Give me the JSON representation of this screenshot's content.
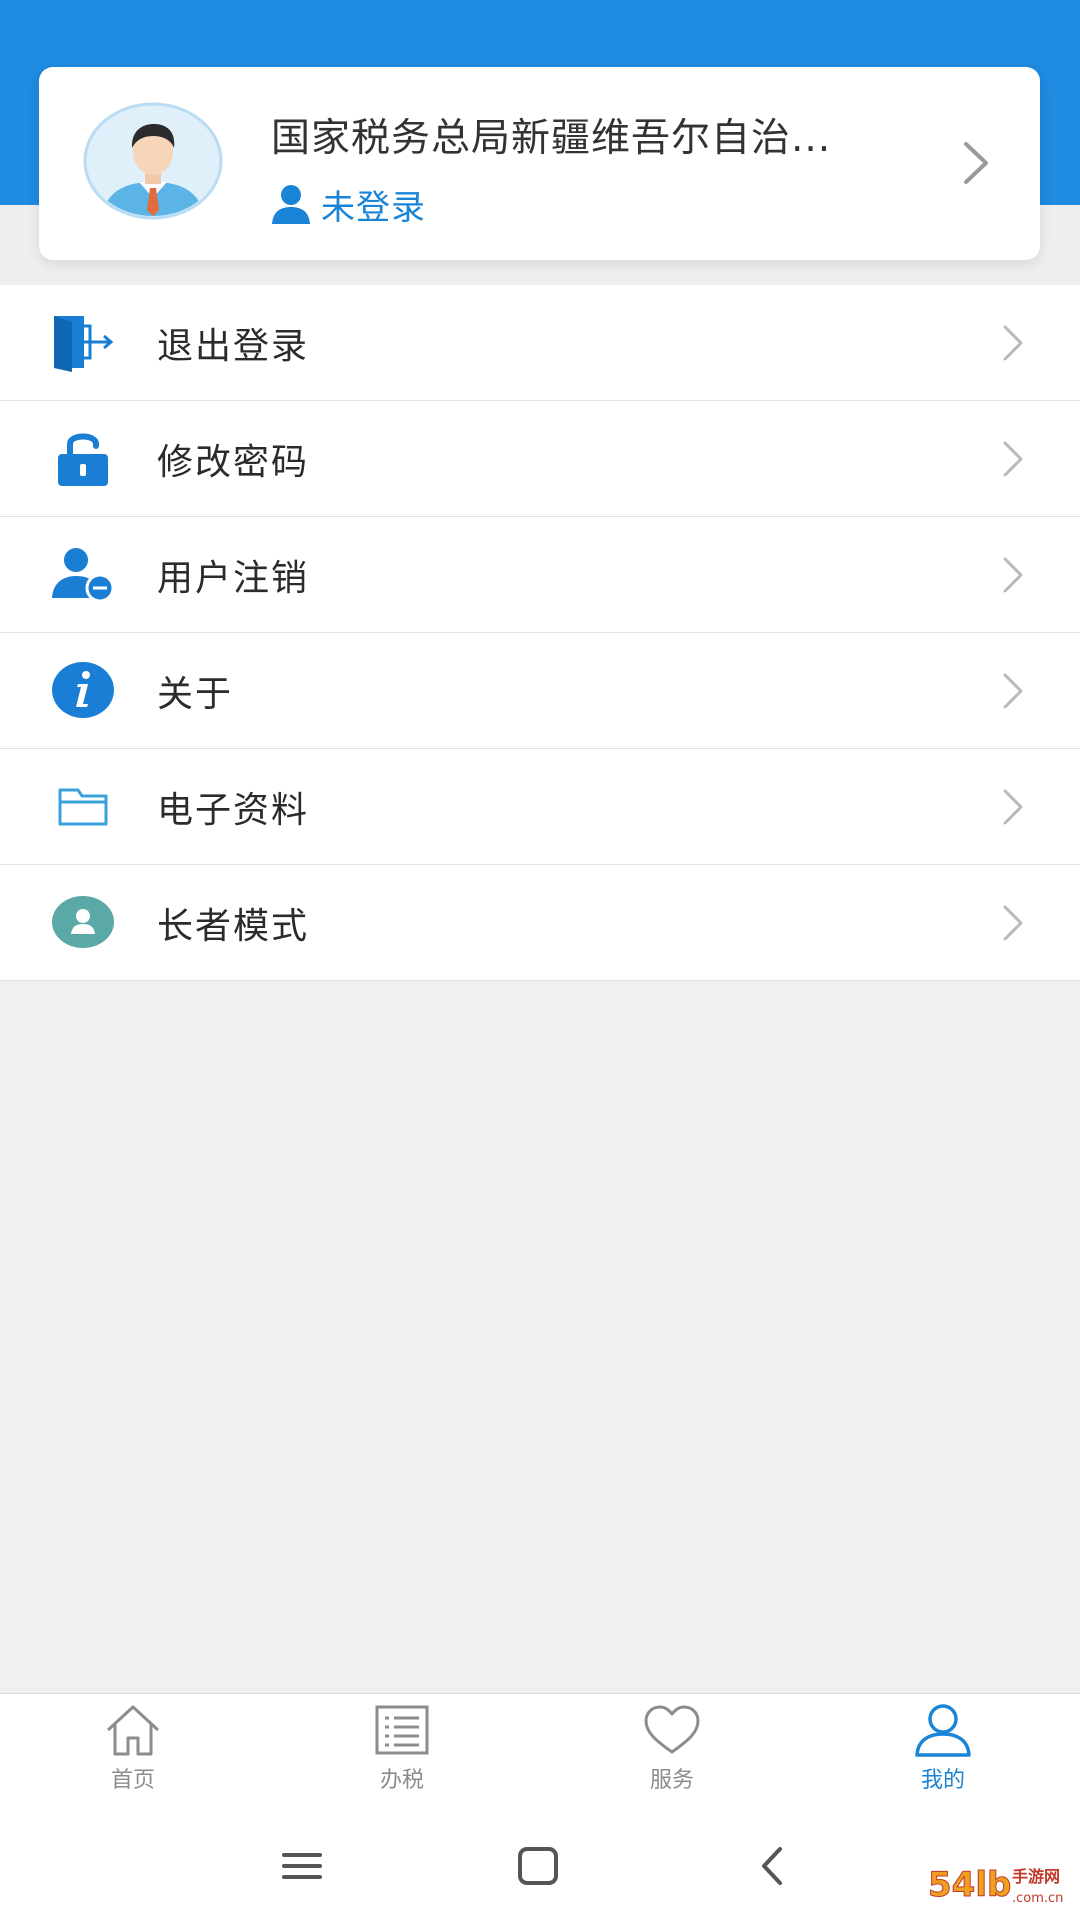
{
  "profile": {
    "org_name": "国家税务总局新疆维吾尔自治...",
    "login_status": "未登录",
    "avatar_icon": "user-avatar-icon",
    "chevron_icon": "chevron-right-icon"
  },
  "menu": {
    "items": [
      {
        "label": "退出登录",
        "icon": "logout-door-icon"
      },
      {
        "label": "修改密码",
        "icon": "lock-icon"
      },
      {
        "label": "用户注销",
        "icon": "user-remove-icon"
      },
      {
        "label": "关于",
        "icon": "info-icon"
      },
      {
        "label": "电子资料",
        "icon": "folder-icon"
      },
      {
        "label": "长者模式",
        "icon": "elder-mode-icon"
      }
    ]
  },
  "tabbar": {
    "tabs": [
      {
        "label": "首页",
        "icon": "home-icon",
        "active": false
      },
      {
        "label": "办税",
        "icon": "list-icon",
        "active": false
      },
      {
        "label": "服务",
        "icon": "heart-icon",
        "active": false
      },
      {
        "label": "我的",
        "icon": "person-icon",
        "active": true
      }
    ]
  },
  "system_nav": {
    "buttons": [
      "recent-apps-icon",
      "home-button-icon",
      "back-icon"
    ]
  },
  "watermark": {
    "text": "54lb手游网 .com.cn"
  },
  "colors": {
    "primary": "#1f8be1",
    "accent_text": "#1a84d6",
    "background": "#f0f0f2",
    "tab_inactive": "#8c8c8c"
  }
}
